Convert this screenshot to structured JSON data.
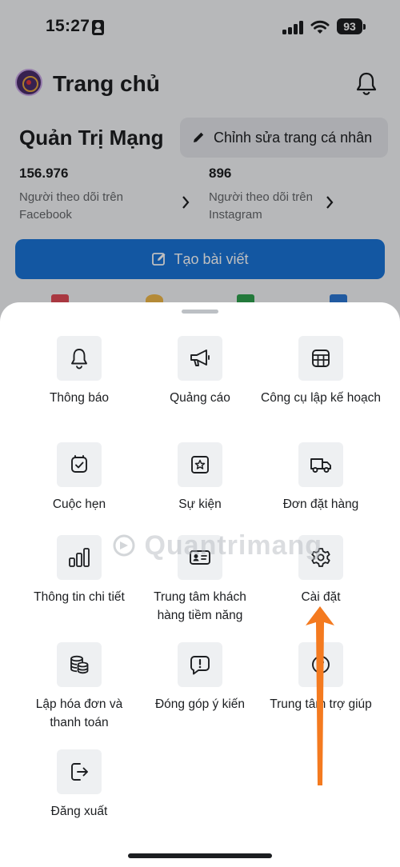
{
  "status_bar": {
    "time": "15:27",
    "battery": "93"
  },
  "header": {
    "title": "Trang chủ"
  },
  "profile": {
    "name": "Quản Trị Mạng",
    "edit_label": "Chỉnh sửa trang cá nhân",
    "stats": [
      {
        "value": "156.976",
        "label": "Người theo dõi trên Facebook"
      },
      {
        "value": "896",
        "label": "Người theo dõi trên Instagram"
      }
    ],
    "create_label": "Tạo bài viết"
  },
  "menu": {
    "items": [
      {
        "label": "Thông báo",
        "icon": "bell-icon"
      },
      {
        "label": "Quảng cáo",
        "icon": "megaphone-icon"
      },
      {
        "label": "Công cụ lập kế hoạch",
        "icon": "calendar-grid-icon"
      },
      {
        "label": "Cuộc hẹn",
        "icon": "appointment-icon"
      },
      {
        "label": "Sự kiện",
        "icon": "event-star-icon"
      },
      {
        "label": "Đơn đặt hàng",
        "icon": "truck-icon"
      },
      {
        "label": "Thông tin chi tiết",
        "icon": "bar-chart-icon"
      },
      {
        "label": "Trung tâm khách hàng tiềm năng",
        "icon": "leads-card-icon"
      },
      {
        "label": "Cài đặt",
        "icon": "gear-icon"
      },
      {
        "label": "Lập hóa đơn và thanh toán",
        "icon": "coins-icon"
      },
      {
        "label": "Đóng góp ý kiến",
        "icon": "feedback-icon"
      },
      {
        "label": "Trung tâm trợ giúp",
        "icon": "help-icon"
      },
      {
        "label": "Đăng xuất",
        "icon": "logout-icon"
      }
    ]
  },
  "watermark": "Quantrimang",
  "colors": {
    "primary": "#1a74d9",
    "annotation_arrow": "#f47a1f",
    "icon_bg": "#eef0f2"
  }
}
